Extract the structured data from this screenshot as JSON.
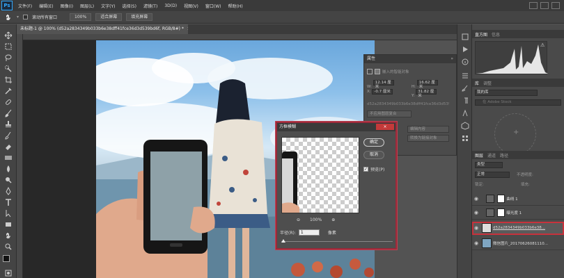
{
  "app": {
    "logo": "Ps",
    "menus": [
      "文件(F)",
      "编辑(E)",
      "图像(I)",
      "图层(L)",
      "文字(Y)",
      "选择(S)",
      "滤镜(T)",
      "3D(D)",
      "视图(V)",
      "窗口(W)",
      "帮助(H)"
    ]
  },
  "options": {
    "scroll_all": "滚动所有窗口",
    "zoom_value": "100%",
    "fit_screen": "适合屏幕",
    "fill_screen": "填充屏幕"
  },
  "document": {
    "tab_title": "未标题-1 @ 100% (d52a2834349b033b6e38dff41fce36d3d539bd6f, RGB/8#) *",
    "close": "×"
  },
  "properties": {
    "title": "属性",
    "subtitle": "嵌入的智能对象",
    "w_label": "W:",
    "w_value": "12.14 厘米",
    "h_label": "H:",
    "h_value": "16.62 厘米",
    "x_label": "X:",
    "x_value": "-0.7 厘米",
    "y_label": "Y:",
    "y_value": "31.82 厘米",
    "file_name": "d52a2834349b033b6e38dff41fce36d3d539",
    "no_comp": "不应用图层复合",
    "edit_contents": "编辑内容",
    "convert_linked": "转换为链接对象"
  },
  "dialog": {
    "title": "方框模糊",
    "close": "×",
    "ok": "确定",
    "cancel": "取消",
    "preview_label": "预览(P)",
    "zoom": "100%",
    "radius_label": "半径(R):",
    "radius_value": "1",
    "radius_unit": "像素"
  },
  "right_panels": {
    "tabs_top": [
      "直方图",
      "信息"
    ],
    "tabs_lib": [
      "库",
      "调整"
    ],
    "library_name": "我的库",
    "search_placeholder": "在 Adobe Stock",
    "tabs_layers": [
      "图层",
      "通道",
      "路径"
    ],
    "filter_kind": "类型",
    "blend_mode": "正常",
    "opacity_label": "不透明度:",
    "lock_label": "锁定:",
    "fill_label": "填充:",
    "layers": [
      {
        "name": "曲线 1",
        "selected": false
      },
      {
        "name": "曝光度 1",
        "selected": false
      },
      {
        "name": "d52a2834349b033b6e38...",
        "selected": true
      },
      {
        "name": "微信图片_20170626081110...",
        "selected": false
      }
    ]
  },
  "colors": {
    "accent": "#31a8ff",
    "highlight_border": "#c8323c",
    "dialog_close": "#c43a3a"
  }
}
